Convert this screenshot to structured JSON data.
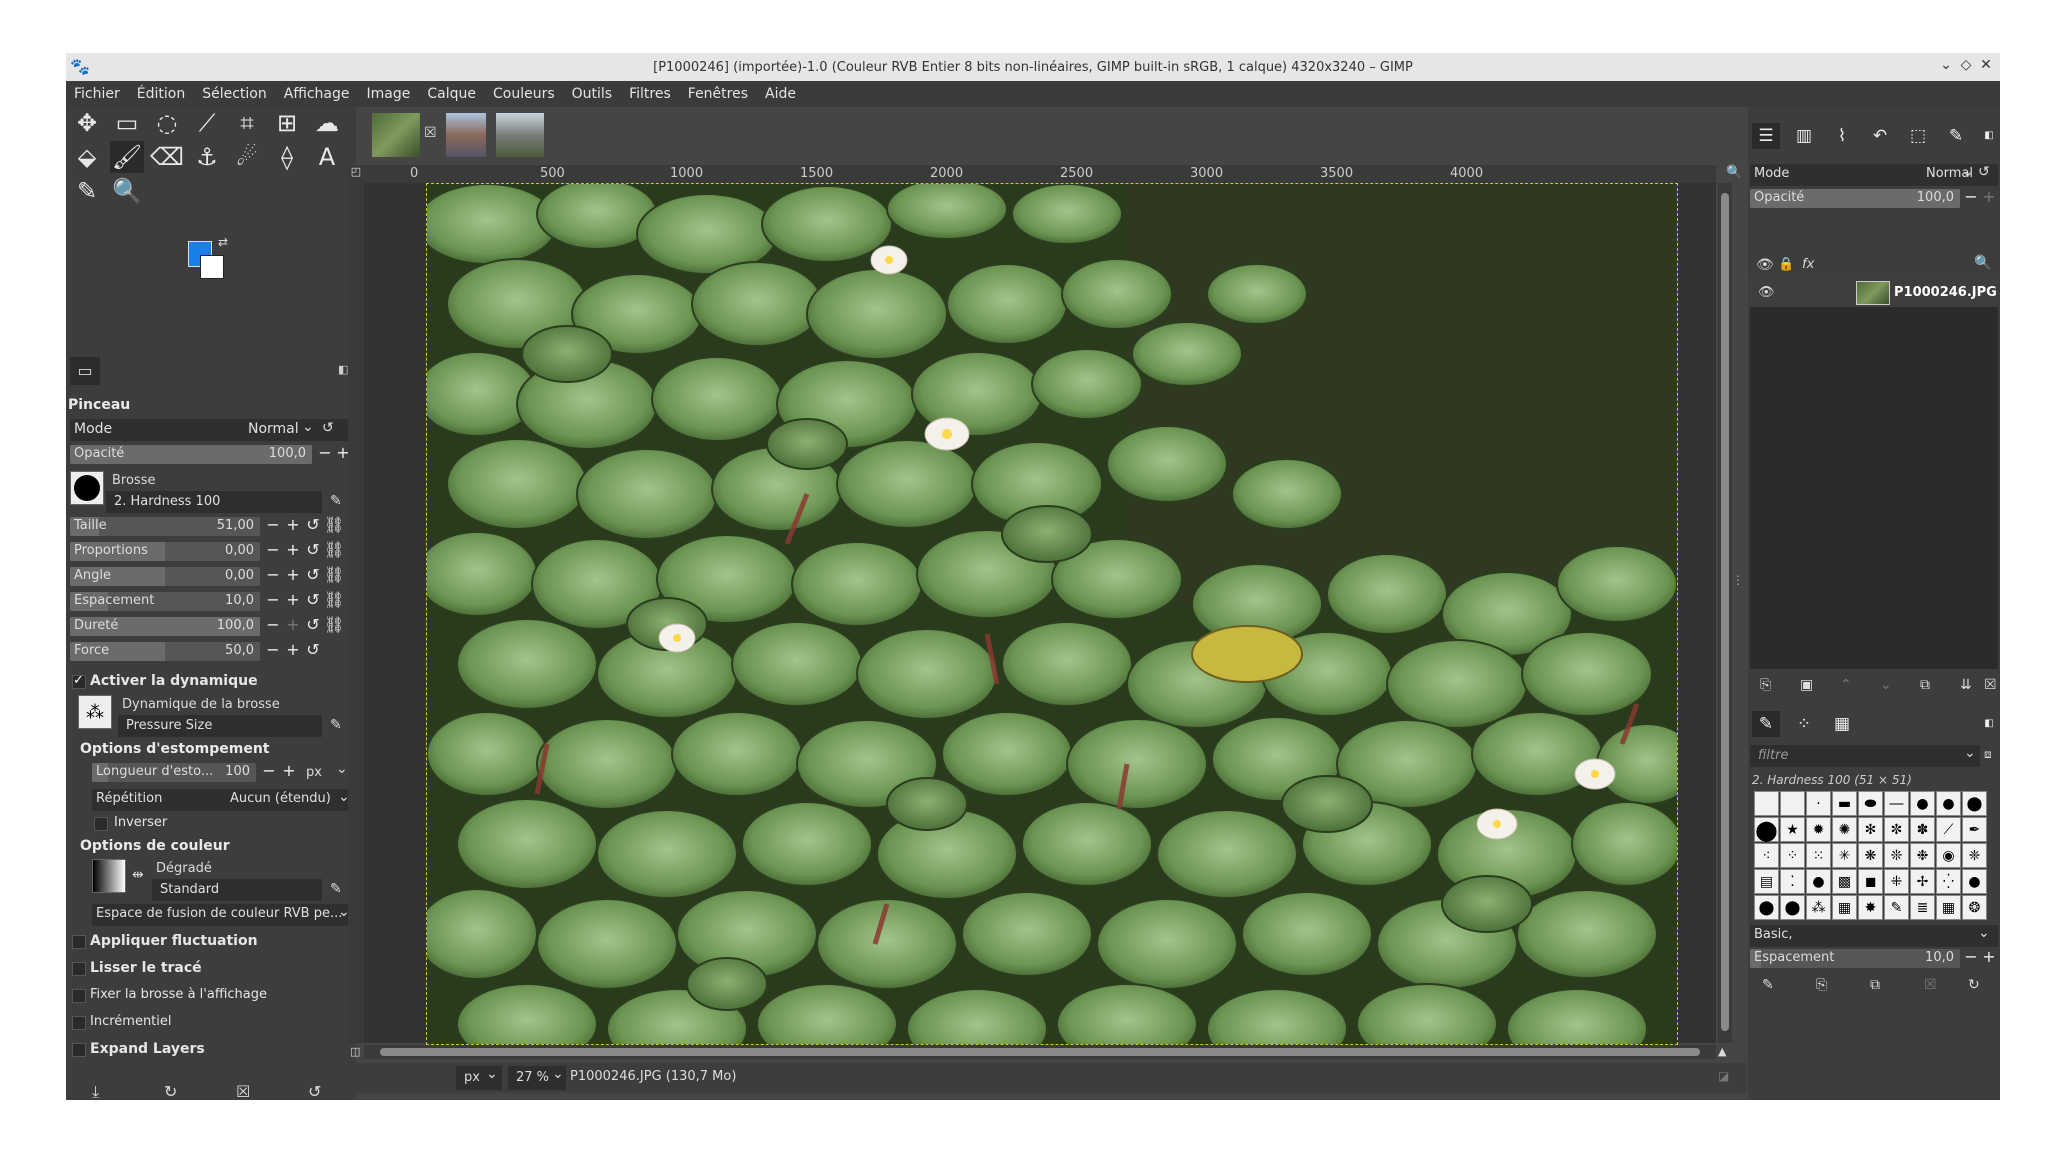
{
  "window": {
    "title": "[P1000246] (importée)-1.0 (Couleur RVB Entier 8 bits non-linéaires, GIMP built-in sRGB, 1 calque) 4320x3240 – GIMP",
    "controls": [
      "⌄",
      "◇",
      "✕"
    ]
  },
  "menu": [
    "Fichier",
    "Édition",
    "Sélection",
    "Affichage",
    "Image",
    "Calque",
    "Couleurs",
    "Outils",
    "Filtres",
    "Fenêtres",
    "Aide"
  ],
  "colors": {
    "foreground": "#1a7fe8",
    "background": "#ffffff"
  },
  "tool_options": {
    "title": "Pinceau",
    "mode_label": "Mode",
    "mode_value": "Normal",
    "opacity_label": "Opacité",
    "opacity_value": "100,0",
    "brush_label": "Brosse",
    "brush_value": "2. Hardness 100",
    "sliders": [
      {
        "label": "Taille",
        "value": "51,00",
        "fill": 0.15
      },
      {
        "label": "Proportions",
        "value": "0,00",
        "fill": 0.5
      },
      {
        "label": "Angle",
        "value": "0,00",
        "fill": 0.5
      },
      {
        "label": "Espacement",
        "value": "10,0",
        "fill": 0.2
      },
      {
        "label": "Dureté",
        "value": "100,0",
        "fill": 1.0
      },
      {
        "label": "Force",
        "value": "50,0",
        "fill": 0.5
      }
    ],
    "dynamics_enable": "Activer la dynamique",
    "dynamics_label": "Dynamique de la brosse",
    "dynamics_value": "Pressure Size",
    "fade_section": "Options d'estompement",
    "fade_length_label": "Longueur d'esto...",
    "fade_length_value": "100",
    "fade_unit": "px",
    "repeat_label": "Répétition",
    "repeat_value": "Aucun (étendu)",
    "invert_label": "Inverser",
    "color_section": "Options de couleur",
    "gradient_label": "Dégradé",
    "gradient_value": "Standard",
    "blend_space": "Espace de fusion de couleur RVB pe...",
    "apply_jitter": "Appliquer fluctuation",
    "smooth_stroke": "Lisser le tracé",
    "lock_brush": "Fixer la brosse à l'affichage",
    "incremental": "Incrémentiel",
    "expand_layers": "Expand Layers"
  },
  "ruler": [
    "0",
    "500",
    "1000",
    "1500",
    "2000",
    "2500",
    "3000",
    "3500",
    "4000"
  ],
  "status": {
    "unit": "px",
    "zoom": "27 %",
    "info": "P1000246.JPG (130,7 Mo)"
  },
  "layers": {
    "mode_label": "Mode",
    "mode_value": "Normal",
    "opacity_label": "Opacité",
    "opacity_value": "100,0",
    "items": [
      {
        "name": "P1000246.JPG"
      }
    ]
  },
  "brushes": {
    "filter_placeholder": "filtre",
    "selected": "2. Hardness 100 (51 × 51)",
    "tag": "Basic,",
    "spacing_label": "Espacement",
    "spacing_value": "10,0"
  }
}
